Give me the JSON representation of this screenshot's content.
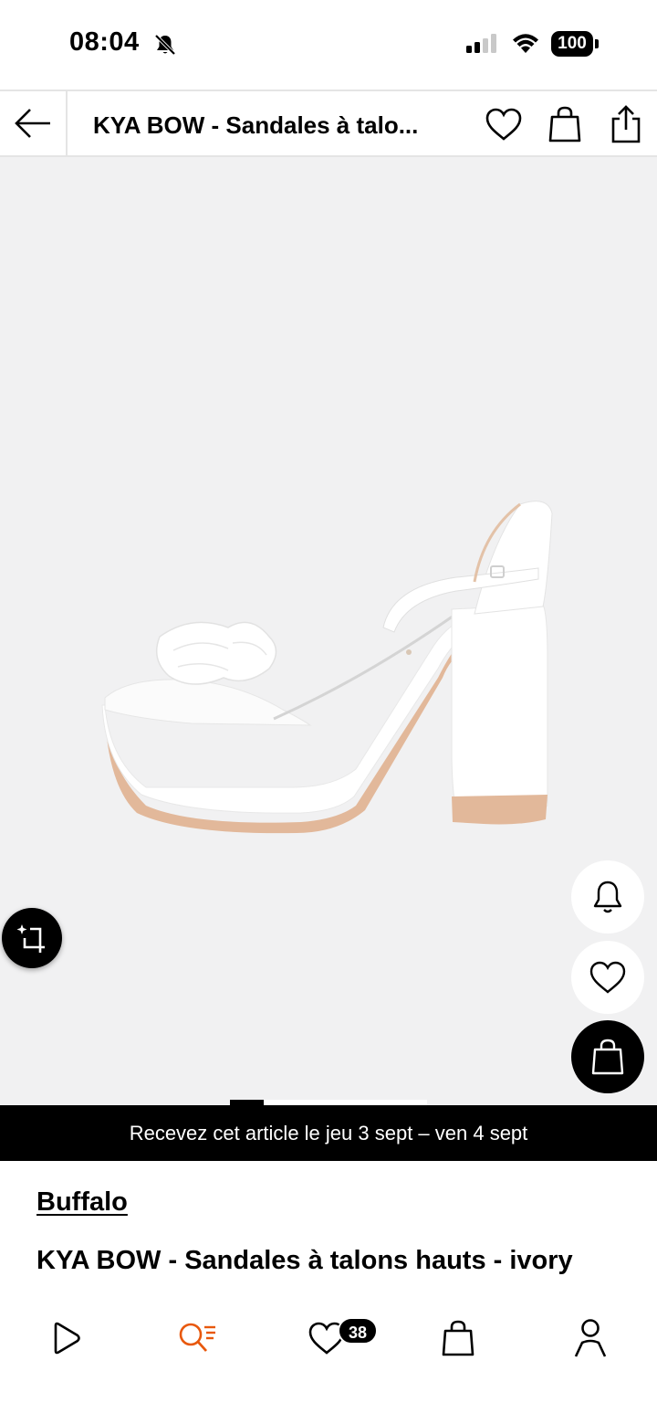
{
  "status_bar": {
    "time": "08:04",
    "battery": "100"
  },
  "header": {
    "title": "KYA BOW - Sandales à talo..."
  },
  "gallery": {
    "image_icon": "sandal-image",
    "page_progress": 0.17
  },
  "delivery_banner": {
    "text": "Recevez cet article le jeu 3 sept – ven 4 sept"
  },
  "product": {
    "brand": "Buffalo",
    "name": "KYA BOW - Sandales à talons hauts - ivory"
  },
  "bottom_nav": {
    "wishlist_count": "38",
    "active_item": "search",
    "active_color": "#e8580c"
  }
}
